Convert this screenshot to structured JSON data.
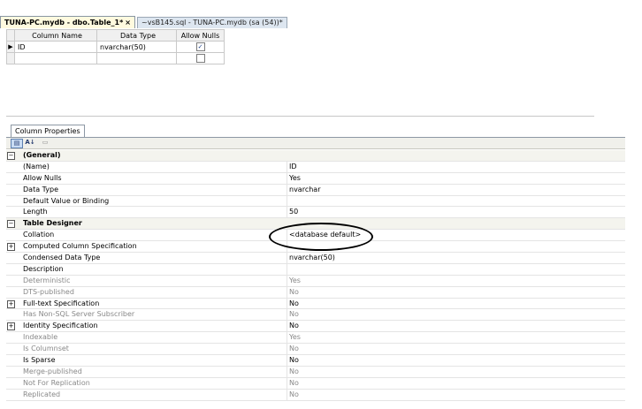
{
  "tabs": [
    {
      "label": "TUNA-PC.mydb - dbo.Table_1*",
      "close": "×",
      "active": true
    },
    {
      "label": "~vsB145.sql - TUNA-PC.mydb (sa (54))*",
      "active": false
    }
  ],
  "grid": {
    "headers": {
      "name": "Column Name",
      "type": "Data Type",
      "nulls": "Allow Nulls"
    },
    "rows": [
      {
        "indicator": "▶",
        "name": "ID",
        "type": "nvarchar(50)",
        "allow_nulls": true
      },
      {
        "indicator": "",
        "name": "",
        "type": "",
        "allow_nulls": false
      }
    ]
  },
  "panel": {
    "tab_label": "Column Properties",
    "toolbar": {
      "categorized_icon": "categorized-icon",
      "alphabetical_icon": "sort-az-icon",
      "pages_icon": "property-pages-icon",
      "az_glyph": "A↓"
    }
  },
  "properties": {
    "general": "(General)",
    "name_label": "(Name)",
    "name_value": "ID",
    "allow_nulls_label": "Allow Nulls",
    "allow_nulls_value": "Yes",
    "data_type_label": "Data Type",
    "data_type_value": "nvarchar",
    "default_label": "Default Value or Binding",
    "default_value": "",
    "length_label": "Length",
    "length_value": "50",
    "table_designer": "Table Designer",
    "collation_label": "Collation",
    "collation_value": "<database default>",
    "computed_label": "Computed Column Specification",
    "computed_value": "",
    "condensed_label": "Condensed Data Type",
    "condensed_value": "nvarchar(50)",
    "description_label": "Description",
    "description_value": "",
    "deterministic_label": "Deterministic",
    "deterministic_value": "Yes",
    "dts_label": "DTS-published",
    "dts_value": "No",
    "fulltext_label": "Full-text Specification",
    "fulltext_value": "No",
    "nonsql_label": "Has Non-SQL Server Subscriber",
    "nonsql_value": "No",
    "identity_label": "Identity Specification",
    "identity_value": "No",
    "indexable_label": "Indexable",
    "indexable_value": "Yes",
    "columnset_label": "Is Columnset",
    "columnset_value": "No",
    "sparse_label": "Is Sparse",
    "sparse_value": "No",
    "merge_label": "Merge-published",
    "merge_value": "No",
    "notrepl_label": "Not For Replication",
    "notrepl_value": "No",
    "replicated_label": "Replicated",
    "replicated_value": "No"
  },
  "glyphs": {
    "collapse": "−",
    "expand": "+",
    "check": "✓"
  }
}
